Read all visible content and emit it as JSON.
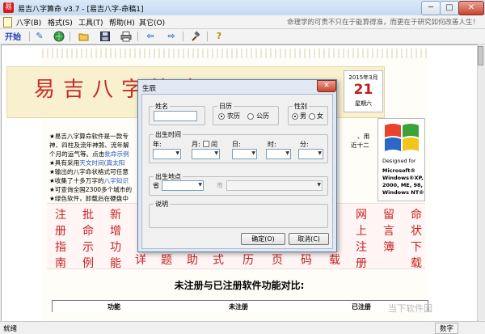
{
  "window": {
    "app_icon_glyph": "易",
    "title": "易吉八字算命 v3.7 - [易吉八字-命稿1]",
    "controls": [
      "─",
      "□",
      "✕"
    ]
  },
  "menu": {
    "items": [
      "八字(B)",
      "格式(S)",
      "工具(T)",
      "帮助(H)",
      "其它(O)"
    ],
    "marquee": "命理学的可贵不只在于能算得准，而更在于研究如何改善人生！"
  },
  "toolbar": {
    "start_label": "开始",
    "icons": [
      "pencil-icon",
      "globe-refresh-icon",
      "folder-open-icon",
      "save-icon",
      "print-icon",
      "arrow-left-icon",
      "arrow-right-icon",
      "hammer-icon",
      "help-icon"
    ]
  },
  "document": {
    "brand_title": "易吉八字算命",
    "date": {
      "year_month": "2015年3月",
      "day": "21",
      "weekday": "星期六"
    },
    "win_logo": {
      "caption_1": "Designed for",
      "caption_2": "Microsoft®",
      "caption_3": "Windows®XP,",
      "caption_4": "2000, ME, 98,",
      "caption_5": "Windows NT®"
    },
    "lines": [
      {
        "text": "★易吉八字算命软件是一款专",
        "link": "",
        "tail": "、用"
      },
      {
        "text": "神、四柱及流年神煞、流年解",
        "link": "",
        "tail": "近十二"
      },
      {
        "text": "个月的运气等。点击",
        "link": "批命示例",
        "tail": ""
      },
      {
        "text": "★具有采用",
        "link": "天文时间(真太阳",
        "tail": ""
      },
      {
        "text": "★输出的八字命状格式可任意",
        "link": "",
        "tail": ""
      },
      {
        "text": "★收集了十多万字的",
        "link": "八字知识",
        "tail": ""
      },
      {
        "text": "★可查询全国2300多个城市的",
        "link": "",
        "tail": ""
      },
      {
        "text": "★绿色软件，卸载后在硬盘中",
        "link": "",
        "tail": ""
      }
    ],
    "calligraphy_left": [
      [
        "注",
        "册",
        "指",
        "南"
      ],
      [
        "批",
        "命",
        "示",
        "例"
      ],
      [
        "新",
        "增",
        "功",
        "能"
      ]
    ],
    "calligraphy_bottom": [
      "详",
      "题",
      "助",
      "式",
      "历",
      "页",
      "码",
      "载"
    ],
    "calligraphy_right": [
      [
        "网",
        "上",
        "注",
        "册"
      ],
      [
        "留",
        "言",
        "簿"
      ],
      [
        "命",
        "状",
        "下",
        "载"
      ]
    ],
    "compare_title": "未注册与已注册软件功能对比:",
    "table_headers": [
      "功能",
      "未注册",
      "已注册"
    ]
  },
  "status": {
    "left": "就绪",
    "mode": "数字"
  },
  "watermark": "当下软件园",
  "dialog": {
    "title": "生辰",
    "name_label": "姓名",
    "name_value": "",
    "calendar_label": "日历",
    "calendar_options": [
      "农历",
      "公历"
    ],
    "calendar_selected": "农历",
    "gender_label": "性别",
    "gender_options": [
      "男",
      "女"
    ],
    "gender_selected": "男",
    "birth_time_label": "出生时间",
    "year_label": "年:",
    "month_label": "月:",
    "leap_label": "闰",
    "day_label": "日:",
    "hour_label": "时:",
    "minute_label": "分:",
    "birth_place_label": "出生地点",
    "province_label": "省",
    "city_label": "市",
    "note_label": "说明",
    "ok_label": "确定(O)",
    "cancel_label": "取消(C)"
  }
}
